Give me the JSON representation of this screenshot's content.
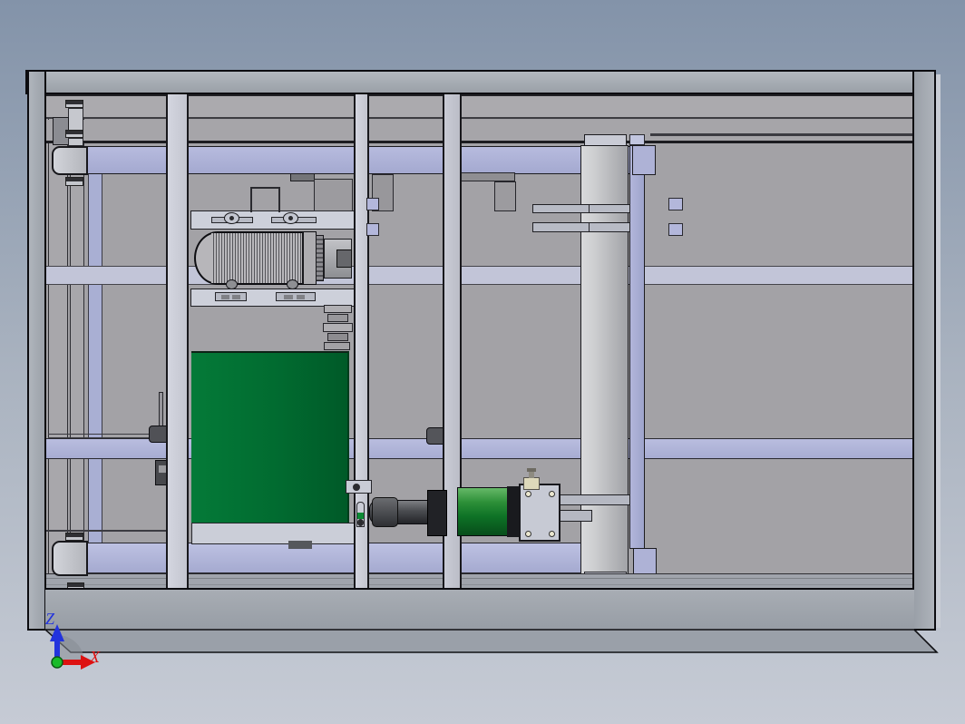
{
  "scene": {
    "type": "cad-shaded-viewport",
    "description": "Shaded orthographic top view of a belt-conveyor frame machine assembly (SolidWorks-style viewport)",
    "parts": [
      "outer-frame",
      "cross-beams",
      "vertical-posts",
      "belt-conveyor-green-panel",
      "drive-motor-with-cooling-fins",
      "gearbox-coupling",
      "pneumatic-cylinder",
      "cylinder-mounting-plate",
      "guide-roller",
      "pillow-block-bearings",
      "tensioner-screws",
      "proximity-sensors",
      "origin-triad"
    ]
  },
  "triad": {
    "z_label": "Z",
    "x_label": "X"
  },
  "colors": {
    "bg_top": "#8393a9",
    "bg_mid": "#aab3c0",
    "bg_bottom": "#c6cbd5",
    "frame_gray": "#a6abb2",
    "panel_gray": "#a3a2a6",
    "beam_lavender": "#aeb2d6",
    "beam_light": "#cdd0da",
    "post_light": "#d4d6e0",
    "belt_green": "#016b30",
    "cylinder_green": "#0e7226",
    "rod_dark": "#232428",
    "roller_light": "#cfd0d2",
    "outline": "#18181c",
    "z_axis": "#2233dd",
    "x_axis": "#dd1111",
    "origin": "#19bb2a"
  }
}
